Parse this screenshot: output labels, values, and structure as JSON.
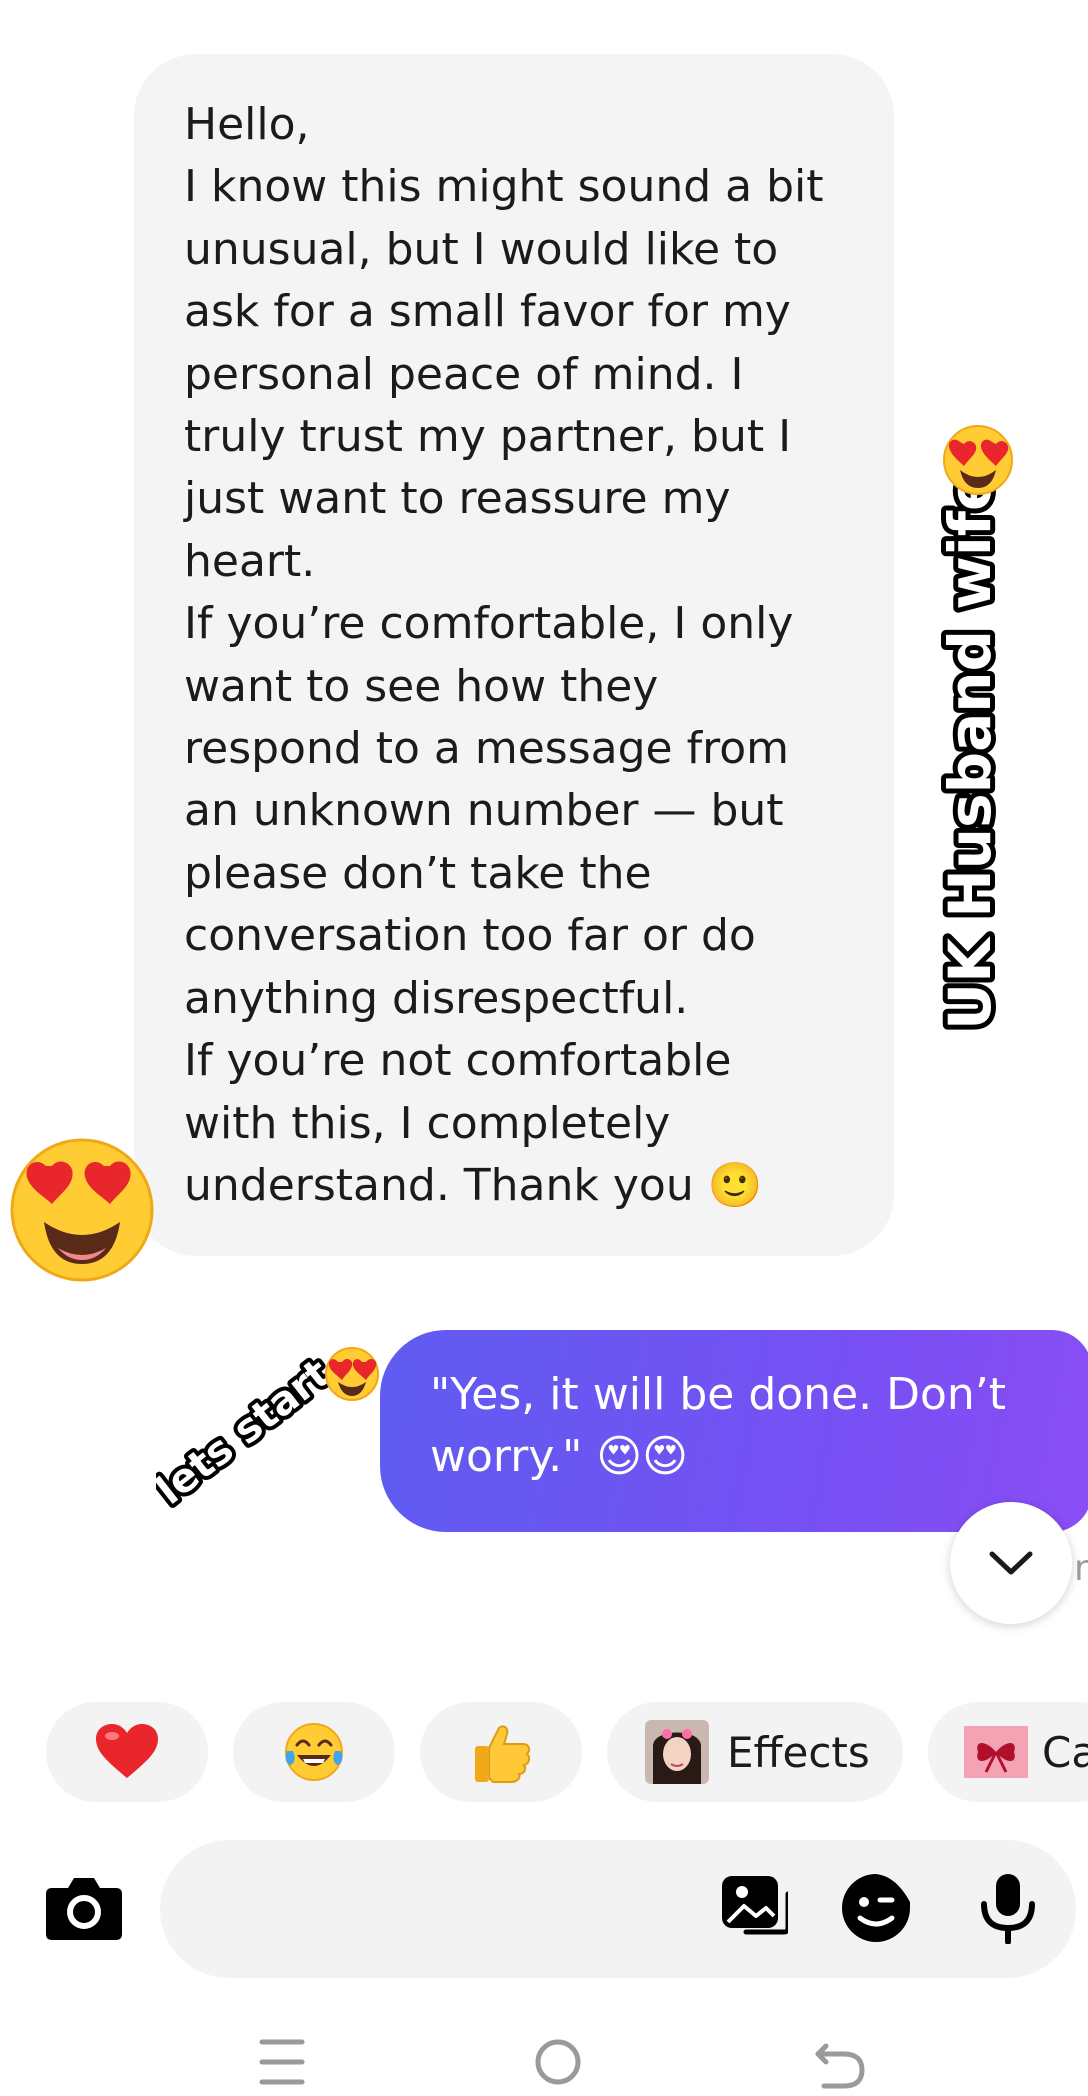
{
  "thread": {
    "incoming_message": {
      "lines": [
        "Hello,",
        "I know this might sound a bit",
        "unusual, but I would like to",
        "ask for a small favor for my",
        "personal peace of mind. I",
        "truly trust my partner, but I",
        "just want to reassure my",
        "heart.",
        "If you’re comfortable, I only",
        "want to see how they",
        "respond to a message from",
        "an unknown number — but",
        "please don’t take the",
        "conversation too far or do",
        "anything disrespectful.",
        "If you’re not comfortable",
        "with this, I completely",
        "understand. Thank you 🙂"
      ],
      "reaction": "heart-eyes"
    },
    "outgoing_message": {
      "lines": [
        "\"Yes, it will be done. Don’t",
        "worry.\" 😍😍"
      ]
    }
  },
  "overlays": {
    "vertical_caption": "UK Husband wife",
    "sticker_text": "lets start"
  },
  "quick_reactions": [
    {
      "icon": "heart",
      "label": ""
    },
    {
      "icon": "tears-of-joy",
      "label": ""
    },
    {
      "icon": "thumbs-up",
      "label": ""
    },
    {
      "icon": "effects-avatar",
      "label": "Effects"
    },
    {
      "icon": "gift-ribbon",
      "label": "Ca"
    }
  ],
  "peek_text": "n",
  "colors": {
    "bubble_in": "#f4f4f5",
    "bubble_out_start": "#5f5cf2",
    "bubble_out_end": "#8a4ef5",
    "chip_bg": "#f3f3f4",
    "text": "#1b1b1b",
    "nav_icons": "#9a9a9a"
  },
  "icons": {
    "camera": "camera-icon",
    "gallery": "gallery-icon",
    "sticker": "sticker-icon",
    "mic": "mic-icon",
    "scroll": "chevron-down-icon",
    "nav_recent": "recent-apps-icon",
    "nav_home": "home-icon",
    "nav_back": "back-icon"
  }
}
